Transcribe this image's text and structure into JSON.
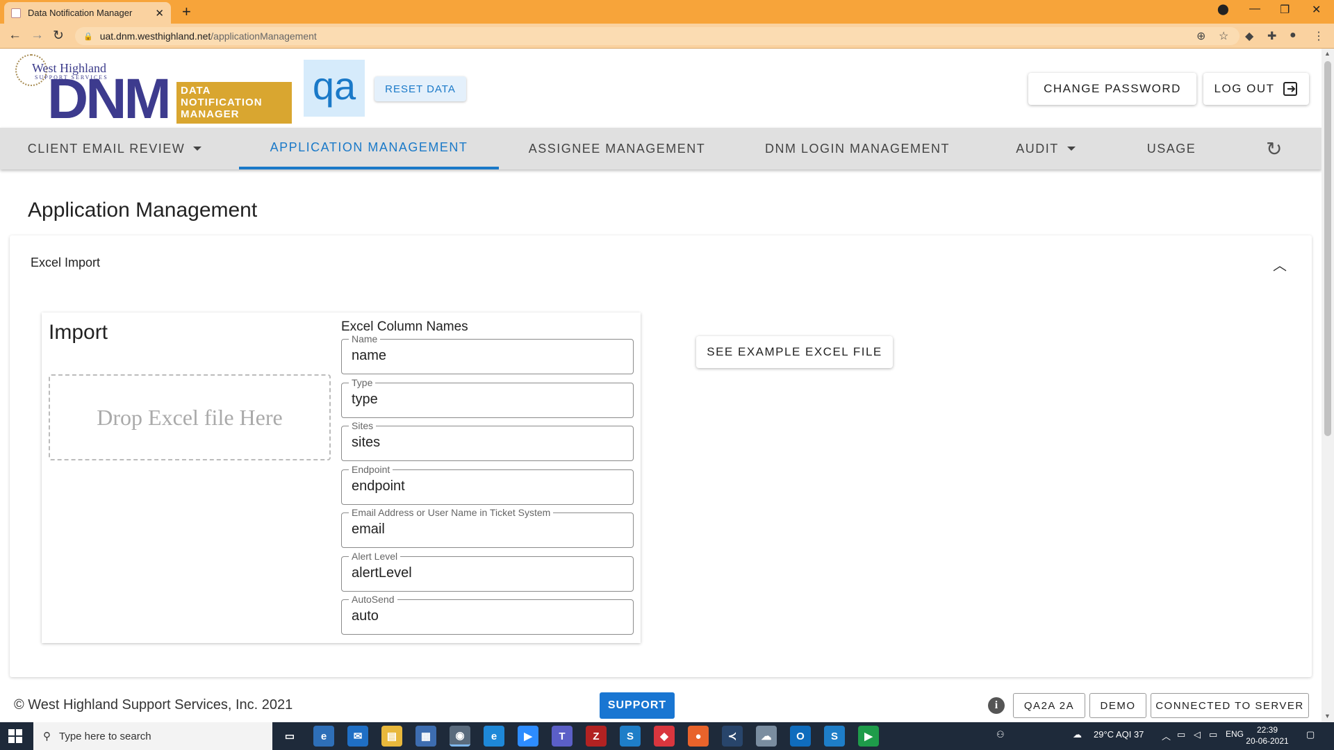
{
  "browser": {
    "tab_title": "Data Notification Manager",
    "url_host": "uat.dnm.westhighland.net",
    "url_path": "/applicationManagement"
  },
  "header": {
    "logo_company": "West Highland",
    "logo_company_sub": "SUPPORT SERVICES",
    "logo_dnm": "DNM",
    "logo_product_line1": "DATA",
    "logo_product_line2": "NOTIFICATION",
    "logo_product_line3": "MANAGER",
    "env_badge": "qa",
    "reset_label": "RESET DATA",
    "change_password_label": "CHANGE PASSWORD",
    "logout_label": "LOG OUT"
  },
  "nav": {
    "tabs": [
      {
        "label": "CLIENT EMAIL REVIEW"
      },
      {
        "label": "APPLICATION MANAGEMENT"
      },
      {
        "label": "ASSIGNEE MANAGEMENT"
      },
      {
        "label": "DNM LOGIN MANAGEMENT"
      },
      {
        "label": "AUDIT"
      },
      {
        "label": "USAGE"
      }
    ],
    "active_tab": "APPLICATION MANAGEMENT"
  },
  "main": {
    "page_title": "Application Management",
    "panel_title": "Excel Import",
    "import_title": "Import",
    "dropzone_text": "Drop Excel file Here",
    "columns_title": "Excel Column Names",
    "fields": [
      {
        "label": "Name",
        "value": "name"
      },
      {
        "label": "Type",
        "value": "type"
      },
      {
        "label": "Sites",
        "value": "sites"
      },
      {
        "label": "Endpoint",
        "value": "endpoint"
      },
      {
        "label": "Email Address or User Name in Ticket System",
        "value": "email"
      },
      {
        "label": "Alert Level",
        "value": "alertLevel"
      },
      {
        "label": "AutoSend",
        "value": "auto"
      }
    ],
    "example_button": "SEE EXAMPLE EXCEL FILE"
  },
  "footer": {
    "copyright": "© West Highland Support Services, Inc. 2021",
    "support_label": "SUPPORT",
    "info_icon": "i",
    "chip_env": "QA2A 2A",
    "chip_demo": "DEMO",
    "chip_connection": "CONNECTED TO SERVER"
  },
  "taskbar": {
    "search_placeholder": "Type here to search",
    "weather": "29°C  AQI 37",
    "language": "ENG",
    "time": "22:39",
    "date": "20-06-2021"
  },
  "colors": {
    "accent": "#1a79c8",
    "support_button": "#1976d2",
    "browser_frame": "#f7a43a",
    "logo_blue": "#3d3b8e",
    "logo_gold": "#d9a630"
  }
}
